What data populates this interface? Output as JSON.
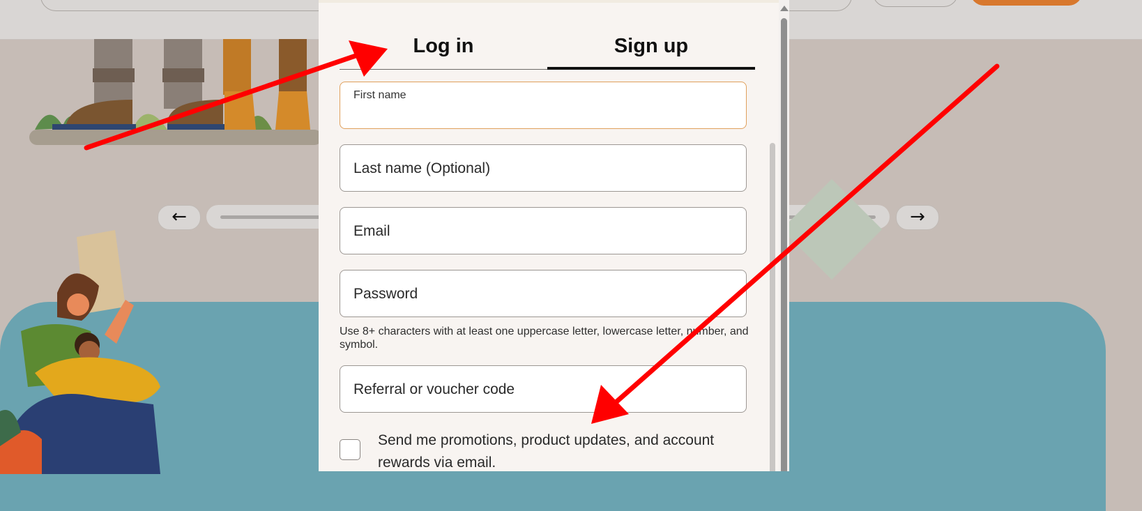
{
  "tabs": {
    "login": "Log in",
    "signup": "Sign up"
  },
  "form": {
    "first_name_label": "First name",
    "first_name_value": "",
    "last_name_placeholder": "Last name (Optional)",
    "email_placeholder": "Email",
    "password_placeholder": "Password",
    "password_hint": "Use 8+ characters with at least one uppercase letter, lowercase letter, number, and symbol.",
    "referral_placeholder": "Referral or voucher code",
    "promo_checkbox_label": "Send me promotions, product updates, and account rewards via email.",
    "promo_checked": false
  },
  "carousel": {
    "prev_icon": "left-arrow-icon",
    "next_icon": "right-arrow-icon",
    "prev_glyph": "←",
    "next_glyph": "→"
  },
  "colors": {
    "annotation_arrow": "#ff0000",
    "accent_orange": "#d8782d",
    "teal_panel": "#6aa3b0",
    "modal_bg": "#f8f4f1"
  }
}
